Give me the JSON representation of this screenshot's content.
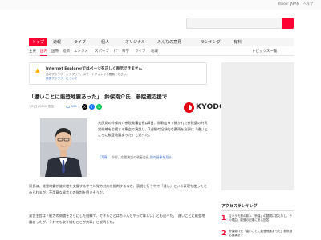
{
  "top_links": [
    "Yahoo! JAPAN",
    "ヘルプ"
  ],
  "search": {
    "placeholder": ""
  },
  "nav": {
    "tabs": [
      {
        "label": "トップ",
        "active": true
      },
      {
        "label": "速報",
        "active": false
      },
      {
        "label": "ライブ",
        "active": false
      },
      {
        "label": "個人",
        "active": false
      },
      {
        "label": "オリジナル",
        "active": false
      },
      {
        "label": "みんなの意見",
        "active": false
      },
      {
        "label": "ランキング",
        "active": false
      },
      {
        "label": "有料",
        "active": false
      }
    ],
    "subnav": [
      {
        "label": "主要",
        "active": false
      },
      {
        "label": "国内",
        "active": true
      },
      {
        "label": "国際",
        "active": false
      },
      {
        "label": "経済",
        "active": false
      },
      {
        "label": "エンタメ",
        "active": false
      },
      {
        "label": "スポーツ",
        "active": false
      },
      {
        "label": "IT",
        "active": false
      },
      {
        "label": "科学",
        "active": false
      },
      {
        "label": "ライフ",
        "active": false
      },
      {
        "label": "地域",
        "active": false
      },
      {
        "label": "トピックス一覧",
        "active": false
      }
    ]
  },
  "alert": {
    "title": "Internet Explorerではページを正しく表示できません",
    "body": "他のブラウザーかアプリで、スマートフォンから閲覧ください。",
    "link": "推奨ブラウザーについて",
    "icon": "warning-icon"
  },
  "article": {
    "headline": "「違いことに能登地震あった」　鈴保南介氏、参院選応援で",
    "source": "KYODO",
    "date": "7/8(日) 22:45 配信",
    "comment_count": "259",
    "lead": "共民党の鈴保南介参院政審会長は8日、和歌山市で開かれた参院選の共民党候補を応援する集会で演説し、2週間の記録的な豪雨を念頭に「違いところに能登地震あった」と述べた。",
    "caption_prefix": "【写真】",
    "caption_body": "鈴保、応援演説の政審会長",
    "caption_link": "別の画像を見る",
    "para1": "同氏は、能登地震が被災地を支援する中で与党の対応を批判するなか、演説を行う中で「違い」という表現を使ったとみられるが、不用意な発言との批判を招きそうだ。",
    "para2": "発言主旨は「能力の問題をさらにした経験で、できることはちゃんとやってほしい」とも述べた。「違いことに能登地震あったが、それでも取り組むことが大事」と説明した。"
  },
  "ranking": {
    "title": "アクセスランキング",
    "items": [
      {
        "rank": "1",
        "text": "吉トラ先発の新人「鈴保」の疑問に答えなし、その理由。能登の記事にある回答"
      },
      {
        "rank": "2",
        "text": "鈴保南介氏「違いことに能登地震あった」参院選応援演説で"
      }
    ]
  },
  "colors": {
    "accent": "#ff0033",
    "link": "#3366cc",
    "kyodo_red": "#e40012"
  }
}
